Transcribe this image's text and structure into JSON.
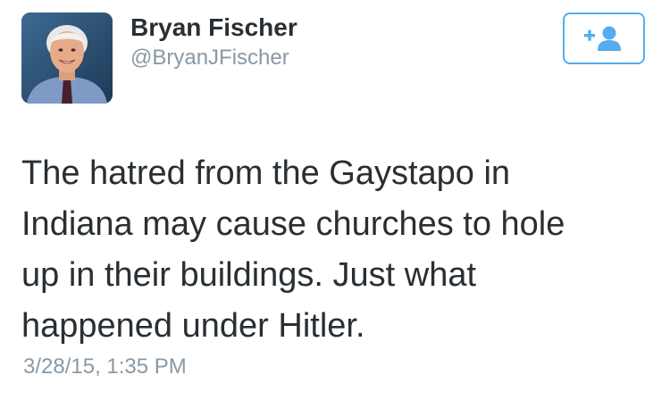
{
  "author": {
    "name": "Bryan Fischer",
    "handle": "@BryanJFischer",
    "avatar_icon": "profile-photo"
  },
  "follow_button": {
    "icon": "follow-user-plus-icon",
    "accent_color": "#55acee"
  },
  "tweet": {
    "lines": [
      "The hatred from the Gaystapo in",
      "Indiana may cause churches to hole",
      "up in their buildings. Just what",
      "happened under Hitler."
    ],
    "timestamp": "3/28/15, 1:35 PM"
  }
}
